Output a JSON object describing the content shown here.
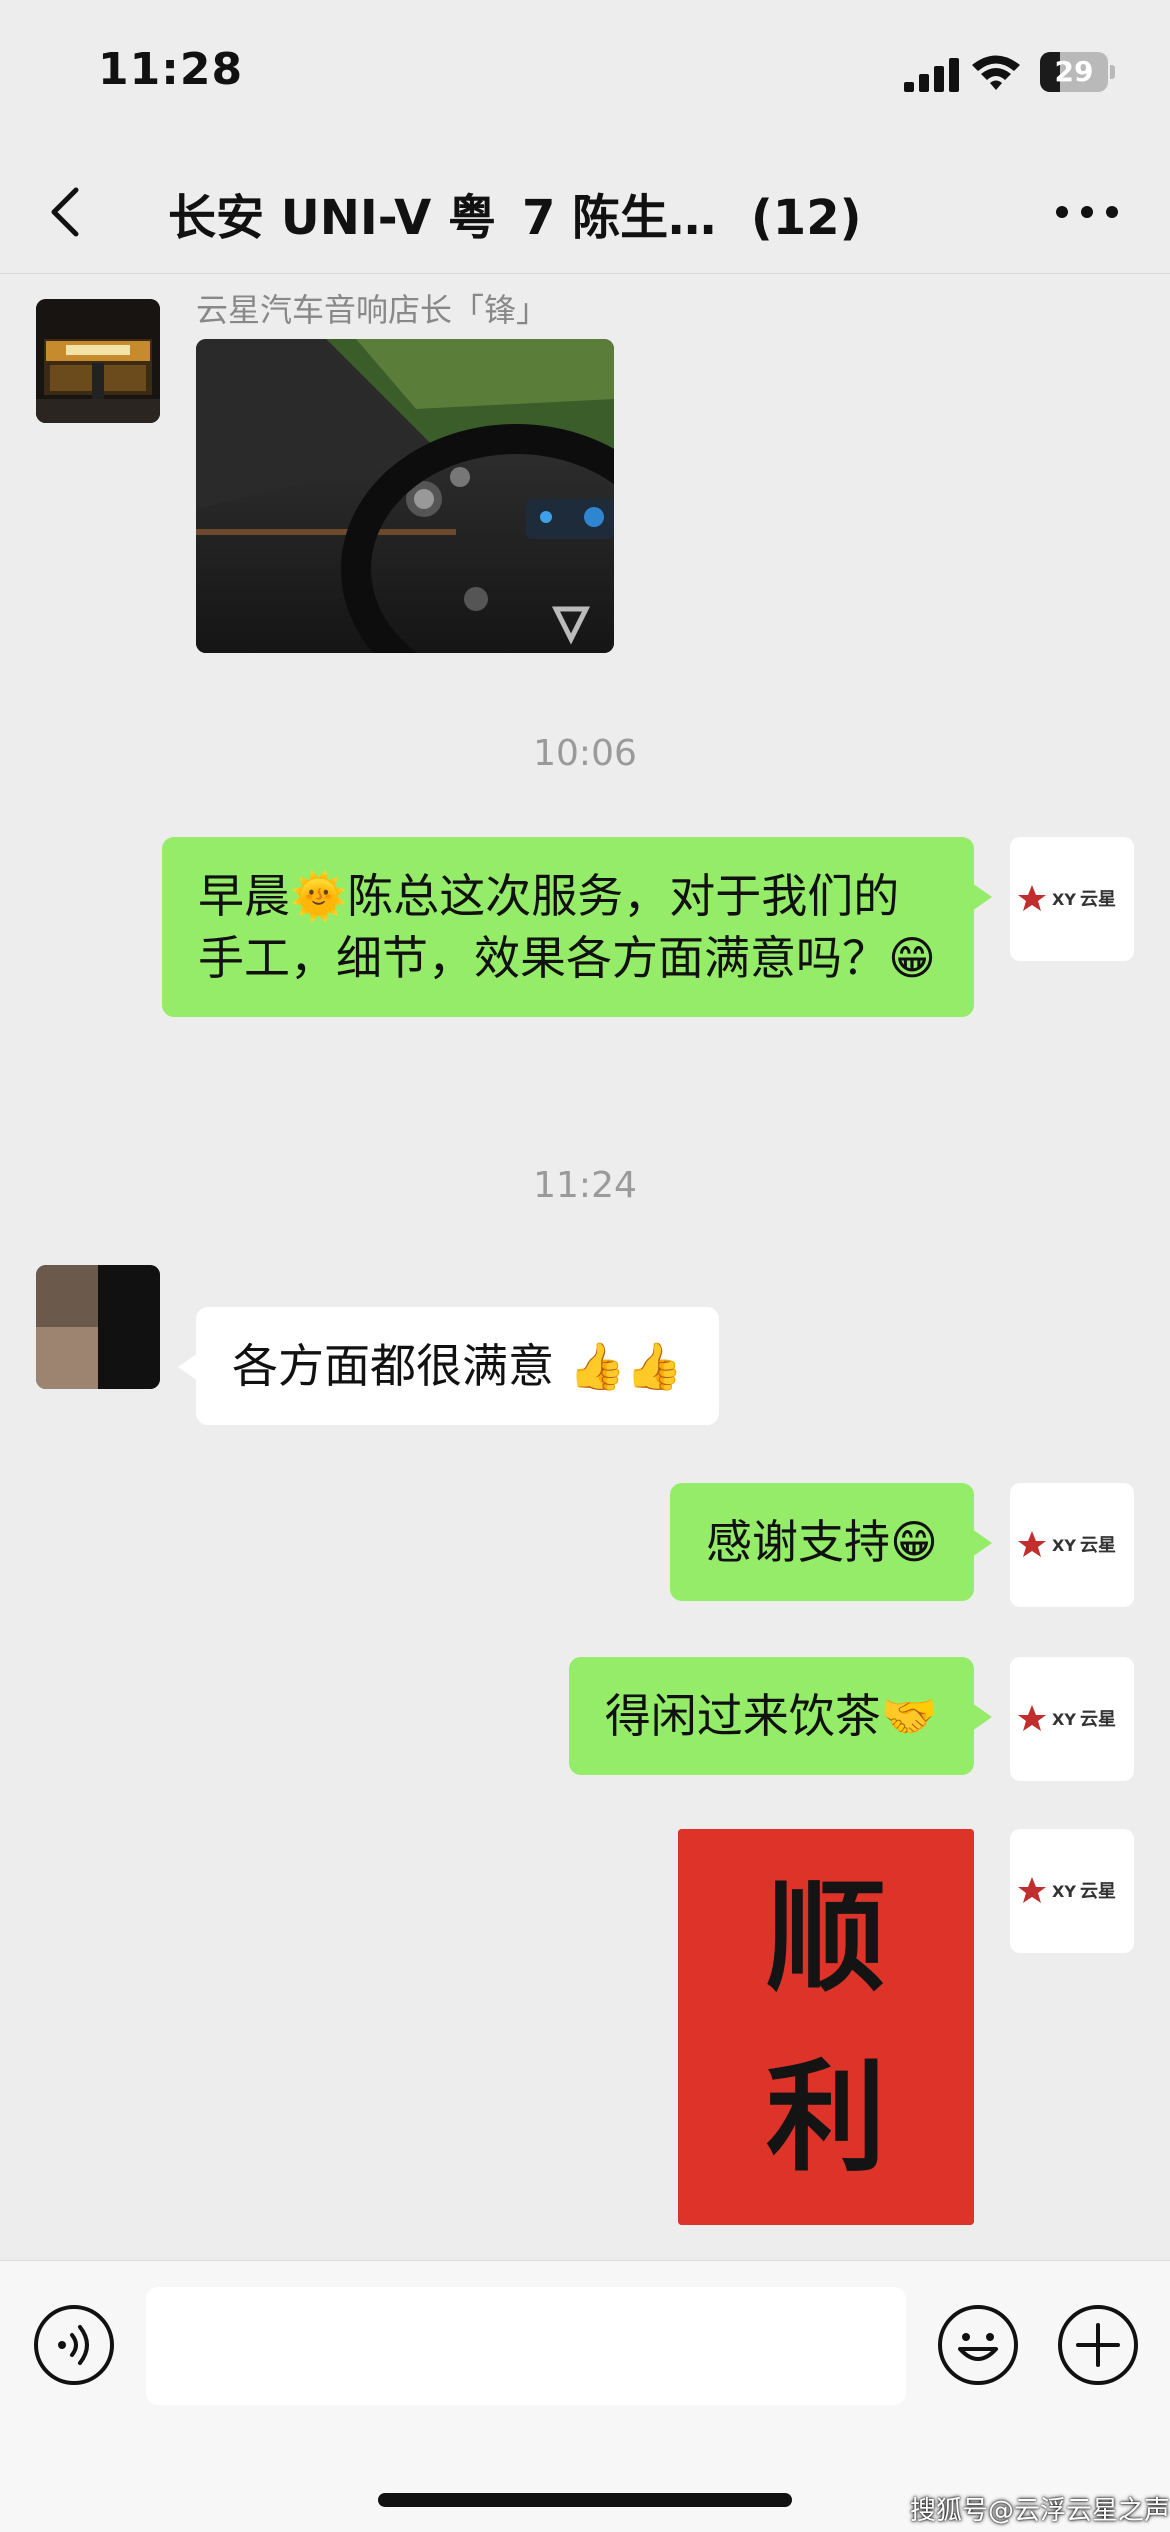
{
  "status_bar": {
    "time": "11:28",
    "battery": "29",
    "battery_level": 0.29,
    "icons": [
      "signal-icon",
      "wifi-icon",
      "battery-icon"
    ]
  },
  "nav": {
    "back_icon": "chevron-left-icon",
    "title_prefix": "长安 UNI-V 粤",
    "title_suffix": "7 陈生…",
    "member_count": "(12)",
    "more_icon": "more-horizontal-icon"
  },
  "messages": {
    "sender_name": "云星汽车音响店长「锋」",
    "time_1": "10:06",
    "msg_1": "早晨🌞陈总这次服务，对于我们的手工，细节，效果各方面满意吗？😁",
    "time_2": "11:24",
    "msg_2": "各方面都很满意 👍👍",
    "msg_3": "感谢支持😁",
    "msg_4": "得闲过来饮茶🤝",
    "image_text": "顺利"
  },
  "brand": {
    "logo_text": "云星",
    "logo_mark": "XY"
  },
  "input_bar": {
    "voice_icon": "voice-icon",
    "emoji_icon": "smile-icon",
    "plus_icon": "plus-circle-icon",
    "input_value": ""
  },
  "watermark": "搜狐号@云浮云星之声",
  "colors": {
    "bubble_green": "#95ec69",
    "background": "#ededed",
    "red_paper": "#e8322c"
  }
}
